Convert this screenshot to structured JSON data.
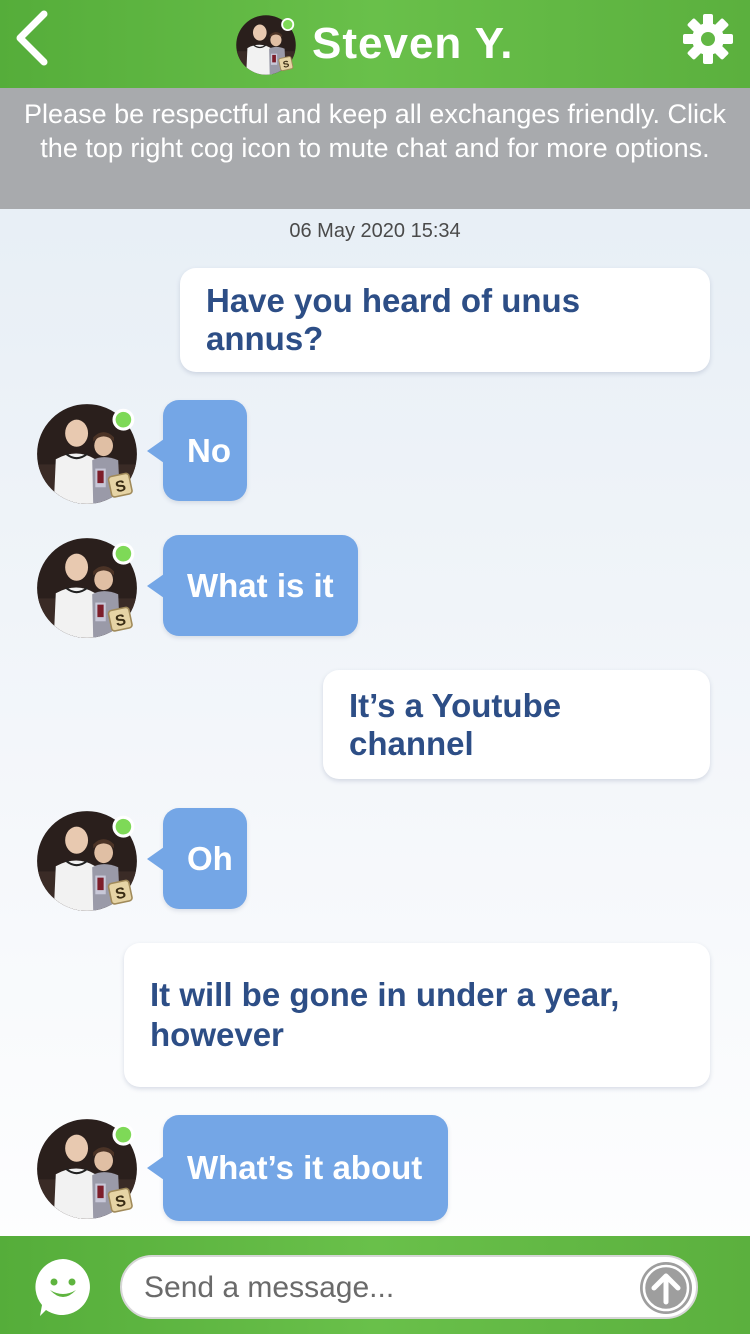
{
  "header": {
    "title": "Steven Y.",
    "back_icon": "chevron-left-icon",
    "settings_icon": "gear-icon",
    "online_color": "#7ed957",
    "brand_green": "#5fb43f"
  },
  "notice": {
    "text": "Please be respectful and keep all exchanges friendly. Click the top right cog icon to mute chat and for more options."
  },
  "conversation": {
    "timestamp": "06 May 2020 15:34",
    "messages": [
      {
        "sender": "me",
        "text": "Have you heard of unus annus?"
      },
      {
        "sender": "Steven Y.",
        "text": "No"
      },
      {
        "sender": "Steven Y.",
        "text": "What is it"
      },
      {
        "sender": "me",
        "text": "It’s a Youtube channel"
      },
      {
        "sender": "Steven Y.",
        "text": "Oh"
      },
      {
        "sender": "me",
        "text": "It will be gone in under a year, however"
      },
      {
        "sender": "Steven Y.",
        "text": "What’s it about"
      }
    ],
    "incoming_bubble_color": "#74a6e6",
    "outgoing_text_color": "#2d4e86"
  },
  "composer": {
    "placeholder": "Send a message...",
    "emoji_icon": "smiley-icon",
    "send_icon": "arrow-up-circle-icon"
  }
}
